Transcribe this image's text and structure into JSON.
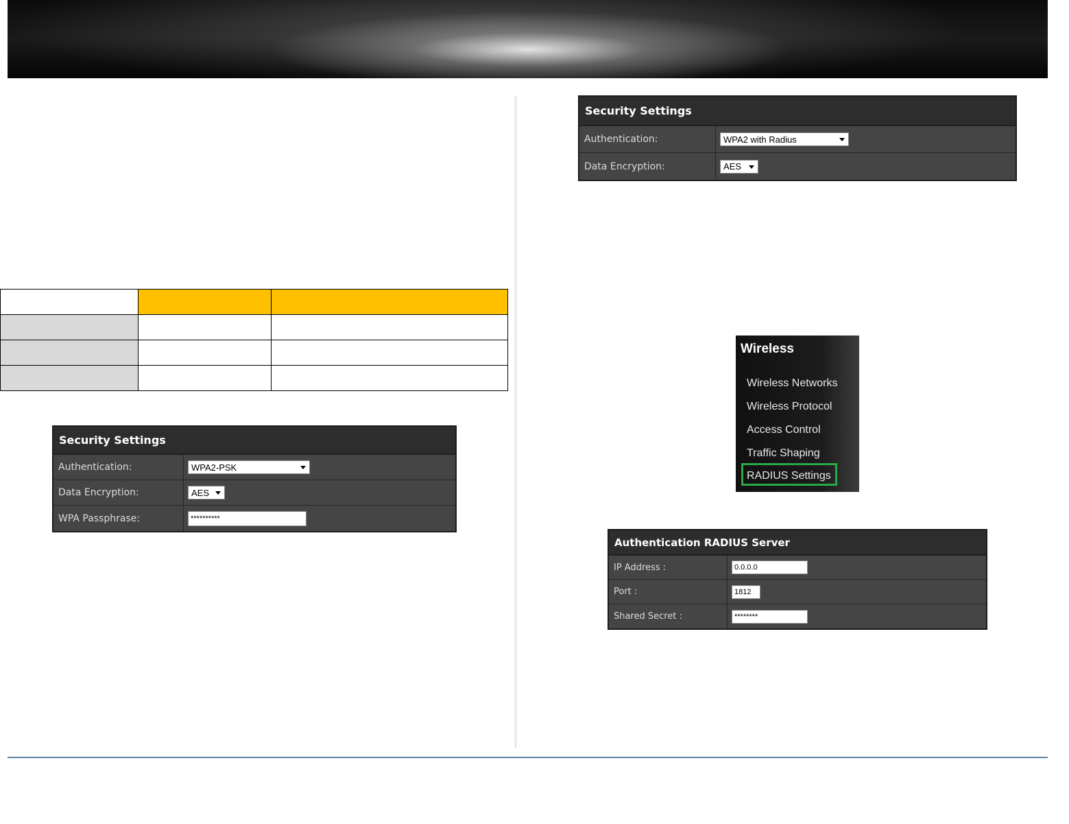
{
  "colors": {
    "table_header_accent": "#ffc000",
    "menu_highlight": "#2aa84a",
    "footer_rule": "#5d84a6"
  },
  "panel_wpa2_psk": {
    "title": "Security Settings",
    "auth_label": "Authentication:",
    "auth_value": "WPA2-PSK",
    "enc_label": "Data Encryption:",
    "enc_value": "AES",
    "pass_label": "WPA Passphrase:",
    "pass_value": "**********"
  },
  "panel_wpa2_radius": {
    "title": "Security Settings",
    "auth_label": "Authentication:",
    "auth_value": "WPA2 with Radius",
    "enc_label": "Data Encryption:",
    "enc_value": "AES"
  },
  "wireless_menu": {
    "title": "Wireless",
    "items": [
      "Wireless Networks",
      "Wireless Protocol",
      "Access Control",
      "Traffic Shaping",
      "RADIUS Settings"
    ],
    "highlighted": "RADIUS Settings"
  },
  "radius_panel": {
    "title": "Authentication RADIUS Server",
    "ip_label": "IP Address :",
    "ip_value": "0.0.0.0",
    "port_label": "Port :",
    "port_value": "1812",
    "secret_label": "Shared Secret :",
    "secret_value": "********"
  }
}
